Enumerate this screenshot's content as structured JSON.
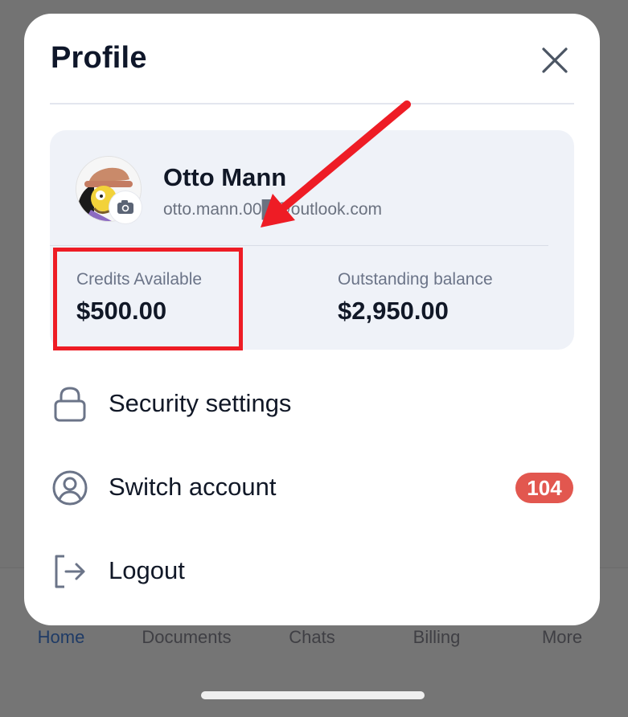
{
  "tabbar": {
    "tabs": [
      {
        "label": "Home",
        "active": true
      },
      {
        "label": "Documents",
        "active": false
      },
      {
        "label": "Chats",
        "active": false
      },
      {
        "label": "Billing",
        "active": false
      },
      {
        "label": "More",
        "active": false
      }
    ]
  },
  "modal": {
    "title": "Profile",
    "close_icon": "close-icon"
  },
  "profile": {
    "name": "Otto Mann",
    "email": "otto.mann.00█@outlook.com",
    "avatar_icon": "cartoon-avatar",
    "camera_icon": "camera-icon"
  },
  "stats": {
    "credits_label": "Credits Available",
    "credits_value": "$500.00",
    "balance_label": "Outstanding balance",
    "balance_value": "$2,950.00"
  },
  "menu": {
    "items": [
      {
        "label": "Security settings",
        "icon": "lock-icon"
      },
      {
        "label": "Switch account",
        "icon": "user-circle-icon",
        "badge": "104"
      },
      {
        "label": "Logout",
        "icon": "logout-icon"
      }
    ]
  },
  "colors": {
    "overlay": "#737373",
    "card_bg": "#eff2f8",
    "badge": "#e2574f",
    "annotation": "#ee1c25",
    "active_tab": "#1f3b66"
  }
}
